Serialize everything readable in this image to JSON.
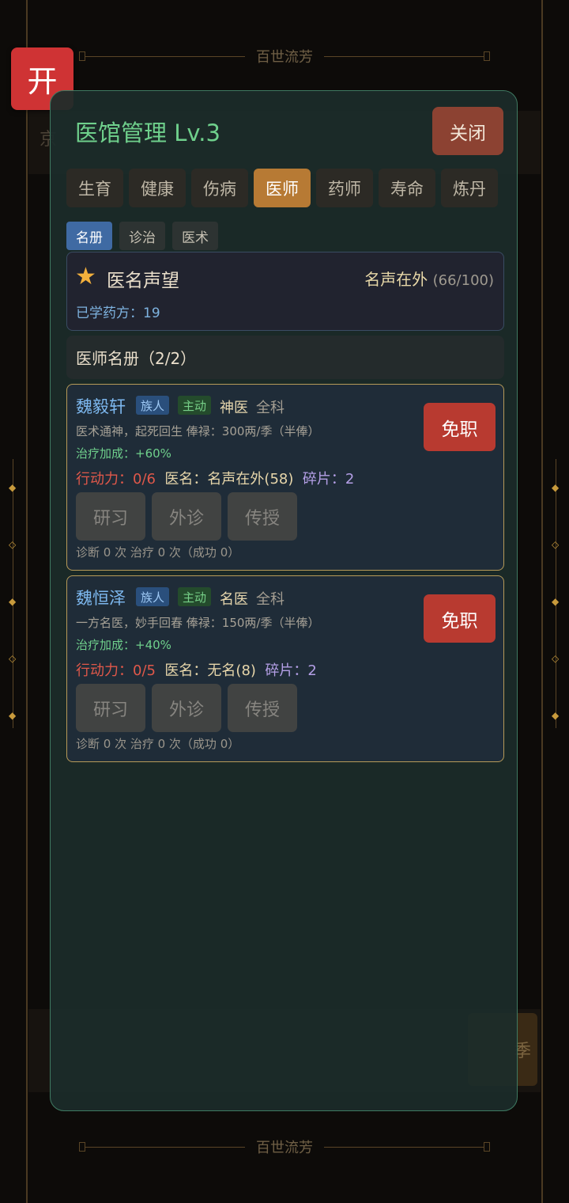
{
  "background": {
    "banner_top": "百世流芳",
    "banner_bottom": "百世流芳"
  },
  "open_button": {
    "label": "开",
    "color": "#cf3334"
  },
  "panel": {
    "title": "医馆管理 Lv.3",
    "close_label": "关闭",
    "tabs": [
      {
        "label": "生育"
      },
      {
        "label": "健康"
      },
      {
        "label": "伤病"
      },
      {
        "label": "医师",
        "active": true
      },
      {
        "label": "药师"
      },
      {
        "label": "寿命"
      },
      {
        "label": "炼丹"
      }
    ],
    "subtabs": [
      {
        "label": "名册",
        "active": true
      },
      {
        "label": "诊治"
      },
      {
        "label": "医术"
      }
    ],
    "fame": {
      "icon": "star-icon",
      "title": "医名声望",
      "level": "名声在外",
      "progress_text": "(66/100)",
      "learned_label": "已学药方：19"
    },
    "roster_title": "医师名册（2/2）",
    "doctors": [
      {
        "name": "魏毅轩",
        "badge_clan": "族人",
        "badge_active": "主动",
        "rank": "神医",
        "specialty": "全科",
        "description": "医术通神，起死回生  俸禄：300两/季（半俸）",
        "bonus": "治疗加成：+60%",
        "action_points": "行动力：0/6",
        "fame_label": "医名：",
        "fame_value": "名声在外(58)",
        "shards": "碎片：2",
        "actions": [
          "研习",
          "外诊",
          "传授"
        ],
        "record": "诊断 0 次    治疗 0 次（成功 0）",
        "dismiss_label": "免职"
      },
      {
        "name": "魏恒泽",
        "badge_clan": "族人",
        "badge_active": "主动",
        "rank": "名医",
        "specialty": "全科",
        "description": "一方名医，妙手回春  俸禄：150两/季（半俸）",
        "bonus": "治疗加成：+40%",
        "action_points": "行动力：0/5",
        "fame_label": "医名：",
        "fame_value": "无名(8)",
        "shards": "碎片：2",
        "actions": [
          "研习",
          "外诊",
          "传授"
        ],
        "record": "诊断 0 次    治疗 0 次（成功 0）",
        "dismiss_label": "免职"
      }
    ]
  }
}
